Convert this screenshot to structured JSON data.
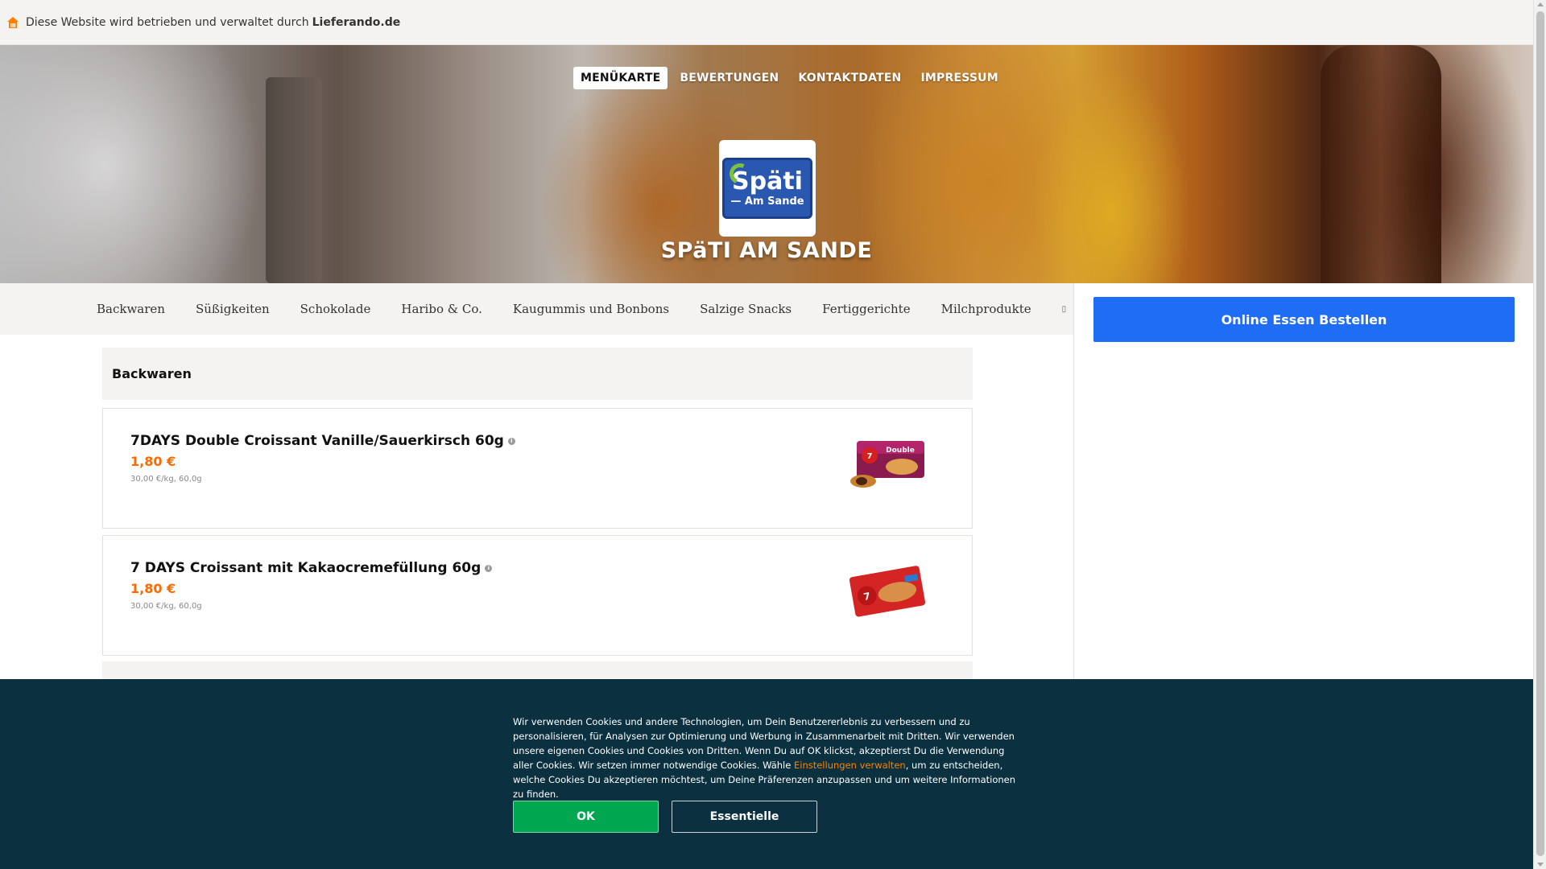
{
  "topbar": {
    "icon": "home-icon",
    "text": "Diese Website wird betrieben und verwaltet durch",
    "brand": "Lieferando.de",
    "accent_color": "#ff8000"
  },
  "nav": {
    "items": [
      {
        "label": "MENÜKARTE",
        "active": true
      },
      {
        "label": "BEWERTUNGEN",
        "active": false
      },
      {
        "label": "KONTAKTDATEN",
        "active": false
      },
      {
        "label": "IMPRESSUM",
        "active": false
      }
    ]
  },
  "restaurant": {
    "logo_line1": "Späti",
    "logo_line2": "— Am Sande",
    "name": "SPäTI AM SANDE"
  },
  "categories": {
    "items": [
      "Backwaren",
      "Süßigkeiten",
      "Schokolade",
      "Haribo & Co.",
      "Kaugummis und Bonbons",
      "Salzige Snacks",
      "Fertiggerichte",
      "Milchprodukte"
    ],
    "more_icon": "more-icon"
  },
  "order": {
    "label": "Online Essen Bestellen",
    "color": "#1f6cf5"
  },
  "menu": {
    "section_title": "Backwaren",
    "products": [
      {
        "name": "7DAYS Double Croissant Vanille/Sauerkirsch 60g",
        "price": "1,80 €",
        "unit": "30,00 €/kg, 60,0g"
      },
      {
        "name": "7 DAYS Croissant mit Kakaocremefüllung 60g",
        "price": "1,80 €",
        "unit": "30,00 €/kg, 60,0g"
      }
    ],
    "price_color": "#ff6a00"
  },
  "cookie": {
    "text_before": "Wir verwenden Cookies und andere Technologien, um Dein Benutzererlebnis zu verbessern und zu personalisieren, für Analysen zur Optimierung und Werbung in Zusammenarbeit mit Dritten. Wir verwenden unsere eigenen Cookies und Cookies von Dritten. Wenn Du auf OK klickst, akzeptierst Du die Verwendung aller Cookies. Wir setzen immer notwendige Cookies. Wähle",
    "link": "Einstellungen verwalten",
    "text_after": ", um zu entscheiden, welche Cookies Du akzeptieren möchtest, um Deine Präferenzen anzupassen und um weitere Informationen zu finden.",
    "ok_label": "OK",
    "essential_label": "Essentielle",
    "background": "#0b3140",
    "ok_color": "#00a650"
  }
}
